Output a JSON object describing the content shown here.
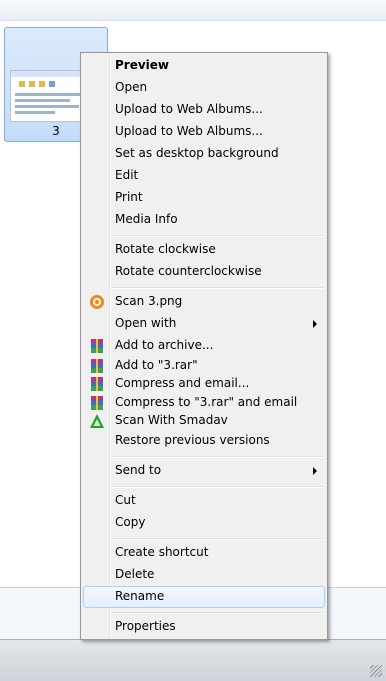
{
  "file": {
    "name": "3"
  },
  "menu": {
    "items": [
      {
        "label": "Preview"
      },
      {
        "label": "Open"
      },
      {
        "label": "Upload to Web Albums..."
      },
      {
        "label": "Upload to Web Albums..."
      },
      {
        "label": "Set as desktop background"
      },
      {
        "label": "Edit"
      },
      {
        "label": "Print"
      },
      {
        "label": "Media Info"
      },
      {
        "label": "Rotate clockwise"
      },
      {
        "label": "Rotate counterclockwise"
      },
      {
        "label": "Scan 3.png",
        "icon": "avast-scan-icon"
      },
      {
        "label": "Open with"
      },
      {
        "label": "Add to archive...",
        "icon": "winrar-icon"
      },
      {
        "label": "Add to \"3.rar\"",
        "icon": "winrar-icon"
      },
      {
        "label": "Compress and email...",
        "icon": "winrar-icon"
      },
      {
        "label": "Compress to \"3.rar\" and email",
        "icon": "winrar-icon"
      },
      {
        "label": "Scan With Smadav",
        "icon": "smadav-icon"
      },
      {
        "label": "Restore previous versions"
      },
      {
        "label": "Send to"
      },
      {
        "label": "Cut"
      },
      {
        "label": "Copy"
      },
      {
        "label": "Create shortcut"
      },
      {
        "label": "Delete"
      },
      {
        "label": "Rename"
      },
      {
        "label": "Properties"
      }
    ]
  },
  "colors": {
    "menu_bg": "#f0f0f0",
    "hover_border": "#aecff7",
    "selection": "#c3dcf8",
    "avast": "#f08a1c",
    "smadav": "#1fa334"
  }
}
